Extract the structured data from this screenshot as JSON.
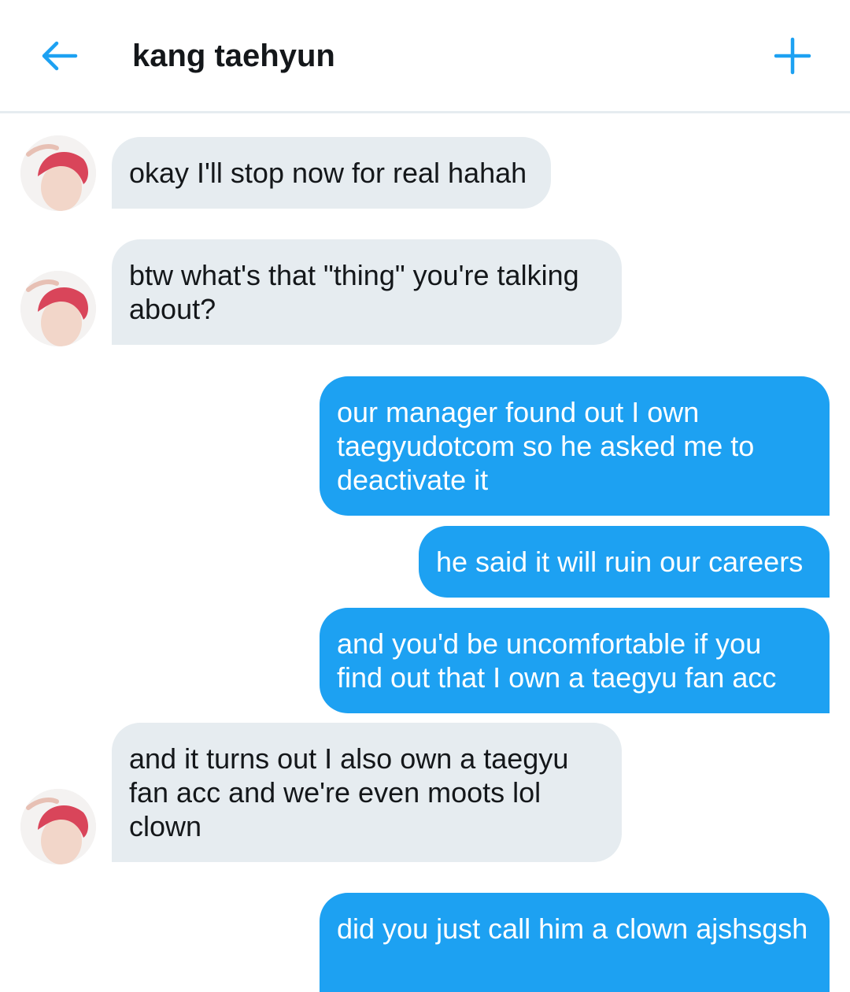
{
  "header": {
    "title": "kang taehyun",
    "back_icon": "arrow-left-icon",
    "add_icon": "plus-icon",
    "accent": "#1da1f2"
  },
  "messages": [
    {
      "side": "in",
      "text": "okay I'll stop now for real hahah"
    },
    {
      "side": "in",
      "text": "btw what's that \"thing\" you're talking about?"
    },
    {
      "side": "out",
      "text": "our manager found out I own taegyudotcom so he asked me to deactivate it"
    },
    {
      "side": "out",
      "text": "he said it will ruin our careers"
    },
    {
      "side": "out",
      "text": "and you'd be uncomfortable if you find out that I own a taegyu fan acc"
    },
    {
      "side": "in",
      "text": "and it turns out I also own a taegyu fan acc and we're even moots lol clown"
    },
    {
      "side": "out",
      "text": "did you just call him a clown ajshsgsh"
    }
  ],
  "colors": {
    "incoming_bubble": "#e6ecf0",
    "outgoing_bubble": "#1da1f2",
    "outgoing_text": "#ffffff",
    "incoming_text": "#14171a"
  }
}
